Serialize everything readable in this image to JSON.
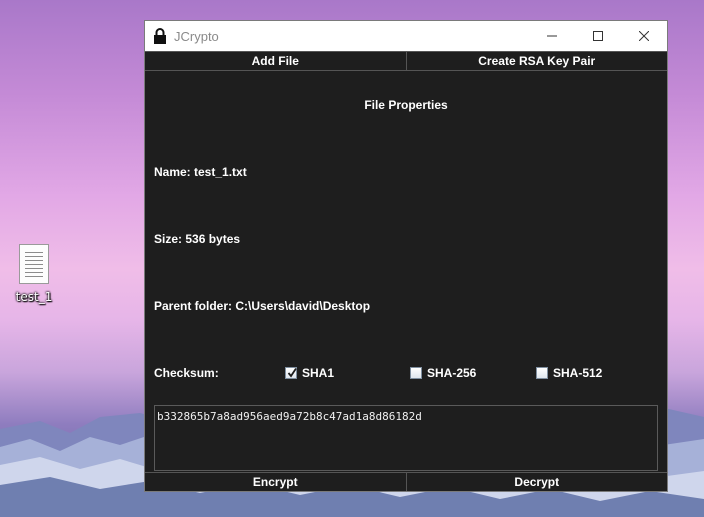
{
  "desktop": {
    "icon_label": "test_1"
  },
  "window": {
    "title": "JCrypto"
  },
  "toolbar": {
    "add_file": "Add File",
    "create_rsa": "Create RSA Key Pair"
  },
  "properties": {
    "heading": "File Properties",
    "name": "Name: test_1.txt",
    "size": "Size: 536 bytes",
    "parent_folder": "Parent folder: C:\\Users\\david\\Desktop",
    "checksum_label": "Checksum:"
  },
  "checksums": [
    {
      "label": "SHA1",
      "checked": true
    },
    {
      "label": "SHA-256",
      "checked": false
    },
    {
      "label": "SHA-512",
      "checked": false
    }
  ],
  "checksum_value": "b332865b7a8ad956aed9a72b8c47ad1a8d86182d",
  "actions": {
    "encrypt": "Encrypt",
    "decrypt": "Decrypt"
  }
}
